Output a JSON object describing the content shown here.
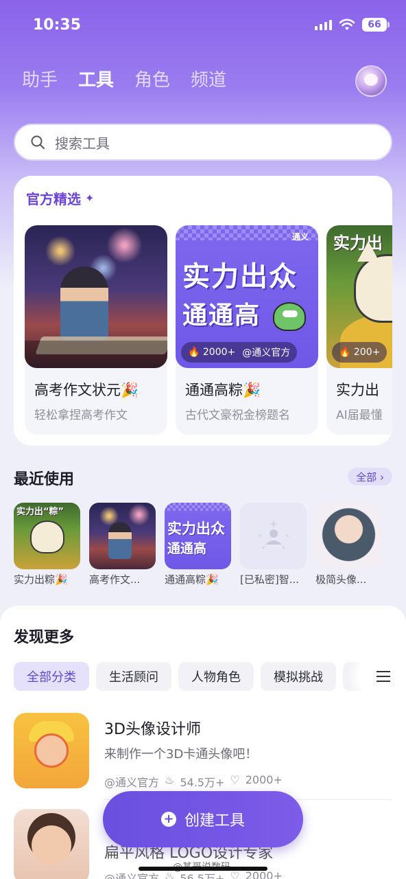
{
  "status": {
    "time": "10:35",
    "battery": "66"
  },
  "nav": {
    "tabs": [
      "助手",
      "工具",
      "角色",
      "频道"
    ]
  },
  "search": {
    "placeholder": "搜索工具"
  },
  "featured": {
    "title": "官方精选",
    "cards": [
      {
        "name": "高考作文状元🎉",
        "desc": "轻松拿捏高考作文"
      },
      {
        "name": "通通高粽🎉",
        "desc": "古代文豪祝金榜题名",
        "stats_count": "🔥 2000+",
        "stats_author": "@通义官方",
        "poster_line1": "实力出众",
        "poster_line2": "通通高",
        "brand": "通义"
      },
      {
        "name": "实力出",
        "desc": "AI届最懂",
        "stats_count": "🔥 200+",
        "poster_label": "实力出"
      }
    ]
  },
  "recent": {
    "title": "最近使用",
    "all_label": "全部 ›",
    "items": [
      {
        "label": "实力出粽🎉",
        "thumb_text": "实力出“粽”"
      },
      {
        "label": "高考作文..."
      },
      {
        "label": "通通高粽🎉",
        "thumb_line1": "实力出众",
        "thumb_line2": "通通高"
      },
      {
        "label": "[已私密]智..."
      },
      {
        "label": "极简头像..."
      }
    ]
  },
  "discover": {
    "title": "发现更多",
    "chips": [
      "全部分类",
      "生活顾问",
      "人物角色",
      "模拟挑战",
      ""
    ],
    "tools": [
      {
        "name": "3D头像设计师",
        "desc": "来制作一个3D卡通头像吧！",
        "author": "@通义官方",
        "uses": "54.5万+",
        "likes": "2000+"
      },
      {
        "name": "扁平风格 LOGO设计专家",
        "desc": "",
        "author": "@通义官方",
        "uses": "56.5万+",
        "likes": "2000+"
      }
    ]
  },
  "create_button": {
    "label": "创建工具"
  },
  "watermark": "@某哥说数码",
  "colors": {
    "accent": "#6a4fe0",
    "header_gradient_top": "#8a63e9",
    "chip_active_bg": "#e5e1fa"
  }
}
